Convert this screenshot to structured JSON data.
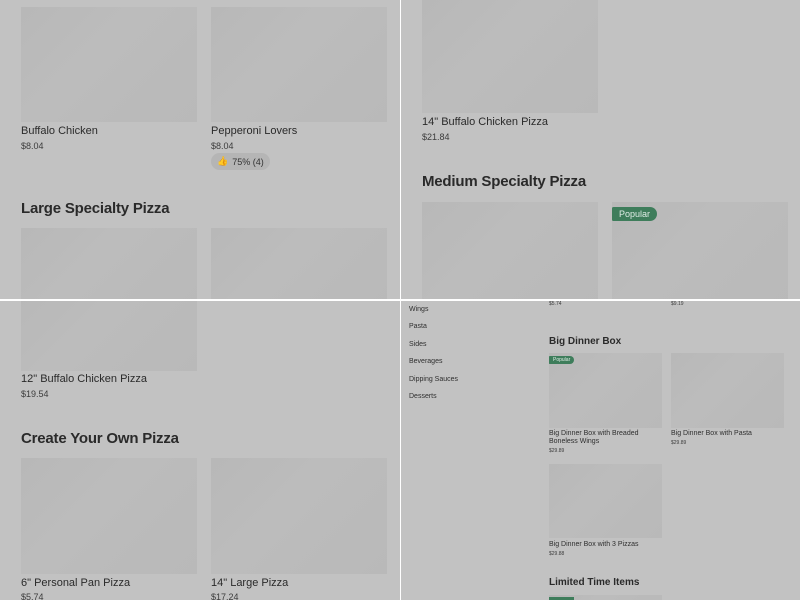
{
  "top_left": {
    "items": [
      {
        "name": "Buffalo Chicken",
        "price": "$8.04"
      },
      {
        "name": "Pepperoni Lovers",
        "price": "$8.04",
        "rating": "75% (4)"
      }
    ],
    "section_title": "Large Specialty Pizza"
  },
  "top_right": {
    "item": {
      "name": "14\" Buffalo Chicken Pizza",
      "price": "$21.84"
    },
    "section_title": "Medium Specialty Pizza",
    "badge": "Popular"
  },
  "bottom_left": {
    "item": {
      "name": "12\" Buffalo Chicken Pizza",
      "price": "$19.54"
    },
    "section_title": "Create Your Own Pizza",
    "items": [
      {
        "name": "6\" Personal Pan Pizza",
        "price": "$5.74"
      },
      {
        "name": "14\" Large Pizza",
        "price": "$17.24"
      }
    ]
  },
  "bottom_right": {
    "top_prices": [
      "$5.74",
      "$9.19"
    ],
    "nav": [
      "Wings",
      "Pasta",
      "Sides",
      "Beverages",
      "Dipping Sauces",
      "Desserts"
    ],
    "section_title": "Big Dinner Box",
    "badge": "Popular",
    "items": [
      {
        "name": "Big Dinner Box with Breaded Boneless Wings",
        "price": "$29.89"
      },
      {
        "name": "Big Dinner Box with Pasta",
        "price": "$29.89"
      },
      {
        "name": "Big Dinner Box with 3 Pizzas",
        "price": "$29.88"
      }
    ],
    "section_title_2": "Limited Time Items"
  }
}
